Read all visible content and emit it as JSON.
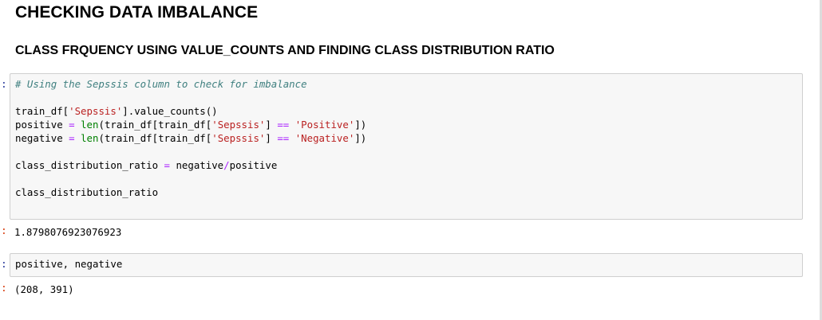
{
  "notebook": {
    "heading": "CHECKING DATA IMBALANCE",
    "subheading": "CLASS FRQUENCY USING VALUE_COUNTS AND FINDING CLASS DISTRIBUTION RATIO",
    "prompt_symbol": ":",
    "cells": [
      {
        "code": {
          "comment": "# Using the Sepssis column to check for imbalance",
          "l2_a": "train_df[",
          "l2_str": "'Sepssis'",
          "l2_b": "].value_counts()",
          "l3_var": "positive",
          "l3_eq": "=",
          "l3_len": "len",
          "l3_a": "(train_df[train_df[",
          "l3_str1": "'Sepssis'",
          "l3_b": "]",
          "l3_op": "==",
          "l3_str2": "'Positive'",
          "l3_c": "])",
          "l4_var": "negative",
          "l4_eq": "=",
          "l4_len": "len",
          "l4_a": "(train_df[train_df[",
          "l4_str1": "'Sepssis'",
          "l4_b": "]",
          "l4_op": "==",
          "l4_str2": "'Negative'",
          "l4_c": "])",
          "l5_var": "class_distribution_ratio",
          "l5_eq": "=",
          "l5_a": "negative",
          "l5_op": "/",
          "l5_b": "positive",
          "l6": "class_distribution_ratio"
        },
        "output": "1.8798076923076923"
      },
      {
        "code": {
          "line": "positive, negative"
        },
        "output": "(208, 391)"
      }
    ]
  },
  "colors": {
    "comment": "#408080",
    "string": "#ba2121",
    "operator": "#aa22ff",
    "builtin": "#008000",
    "cell_background": "#f7f7f7",
    "cell_border": "#cfcfcf"
  }
}
